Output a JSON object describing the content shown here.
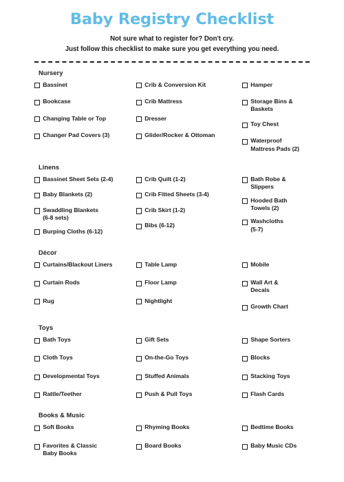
{
  "header": {
    "title": "Baby Registry Checklist",
    "subtitle_line1": "Not sure what to register for? Don't cry.",
    "subtitle_line2": "Just follow this checklist to make sure you get everything you need.",
    "title_color": "#62bce5",
    "text_color": "#1b1b1b"
  },
  "sections": [
    {
      "title": "Nursery",
      "columns": [
        [
          "Bassinet",
          "Bookcase",
          "Changing Table or Top",
          "Changer Pad Covers (3)"
        ],
        [
          "Crib & Conversion Kit",
          "Crib Mattress",
          "Dresser",
          "Glider/Rocker & Ottoman"
        ],
        [
          "Hamper",
          "Storage Bins &\nBaskets",
          "Toy Chest",
          "Waterproof\nMattress Pads (2)"
        ]
      ]
    },
    {
      "title": "Linens",
      "columns": [
        [
          "Bassinet Sheet Sets (2-4)",
          "Baby Blankets (2)",
          "Swaddling Blankets\n(6-8 sets)",
          "Burping Cloths (6-12)"
        ],
        [
          "Crib Quilt (1-2)",
          "Crib Fitted Sheets (3-4)",
          "Crib Skirt (1-2)",
          "Bibs (6-12)"
        ],
        [
          "Bath Robe &\nSlippers",
          "Hooded Bath\nTowels (2)",
          "Washcloths\n(5-7)"
        ]
      ]
    },
    {
      "title": "Décor",
      "columns": [
        [
          "Curtains/Blackout Liners",
          "Curtain Rods",
          "Rug"
        ],
        [
          "Table Lamp",
          "Floor Lamp",
          "Nightlight"
        ],
        [
          "Mobile",
          "Wall Art &\nDecals",
          "Growth Chart"
        ]
      ]
    },
    {
      "title": "Toys",
      "columns": [
        [
          "Bath Toys",
          "Cloth Toys",
          "Developmental Toys",
          "Rattle/Teether"
        ],
        [
          "Gift Sets",
          "On-the-Go Toys",
          "Stuffed Animals",
          "Push & Pull Toys"
        ],
        [
          "Shape Sorters",
          "Blocks",
          "Stacking Toys",
          "Flash Cards"
        ]
      ]
    },
    {
      "title": "Books & Music",
      "columns": [
        [
          "Soft Books",
          "Favorites & Classic\nBaby Books"
        ],
        [
          "Rhyming Books",
          "Board Books"
        ],
        [
          "Bedtime Books",
          "Baby Music CDs"
        ]
      ]
    }
  ]
}
